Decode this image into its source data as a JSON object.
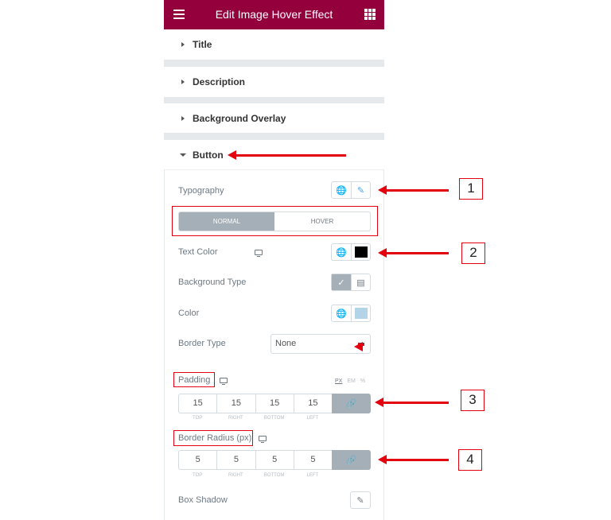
{
  "header": {
    "title": "Edit Image Hover Effect",
    "menu_icon": "hamburger-icon",
    "apps_icon": "grid-icon",
    "color": "#93003c"
  },
  "sections": [
    {
      "label": "Title",
      "expanded": false
    },
    {
      "label": "Description",
      "expanded": false
    },
    {
      "label": "Background Overlay",
      "expanded": false
    },
    {
      "label": "Button",
      "expanded": true
    }
  ],
  "button": {
    "typography_label": "Typography",
    "tabs": [
      "NORMAL",
      "HOVER"
    ],
    "active_tab": "NORMAL",
    "text_color_label": "Text Color",
    "text_color": "#000000",
    "background_type_label": "Background Type",
    "color_label": "Color",
    "color_value": "#b3d4e8",
    "border_type_label": "Border Type",
    "border_type_value": "None",
    "padding_label": "Padding",
    "units": [
      "PX",
      "EM",
      "%"
    ],
    "active_unit": "PX",
    "padding": {
      "top": "15",
      "right": "15",
      "bottom": "15",
      "left": "15"
    },
    "dimension_labels": [
      "TOP",
      "RIGHT",
      "BOTTOM",
      "LEFT"
    ],
    "border_radius_label": "Border Radius (px)",
    "border_radius": {
      "top": "5",
      "right": "5",
      "bottom": "5",
      "left": "5"
    },
    "box_shadow_label": "Box Shadow"
  },
  "annotations": {
    "callouts": [
      "1",
      "2",
      "3",
      "4"
    ],
    "color": "#e3000f"
  }
}
